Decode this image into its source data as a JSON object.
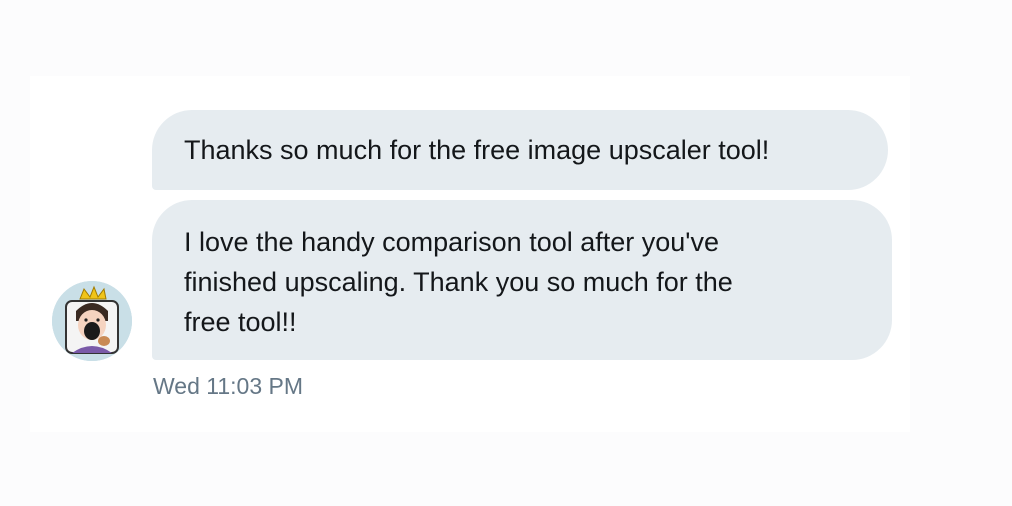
{
  "conversation": {
    "messages": [
      {
        "text": "Thanks so much for the free image upscaler tool!"
      },
      {
        "lines": [
          "I love the handy comparison tool after you've",
          "finished upscaling. Thank you so much for the",
          "free tool!!"
        ]
      }
    ],
    "timestamp": "Wed 11:03 PM",
    "colors": {
      "bubble": "#e6ecf0",
      "text": "#14171a",
      "timestamp": "#657786"
    }
  }
}
